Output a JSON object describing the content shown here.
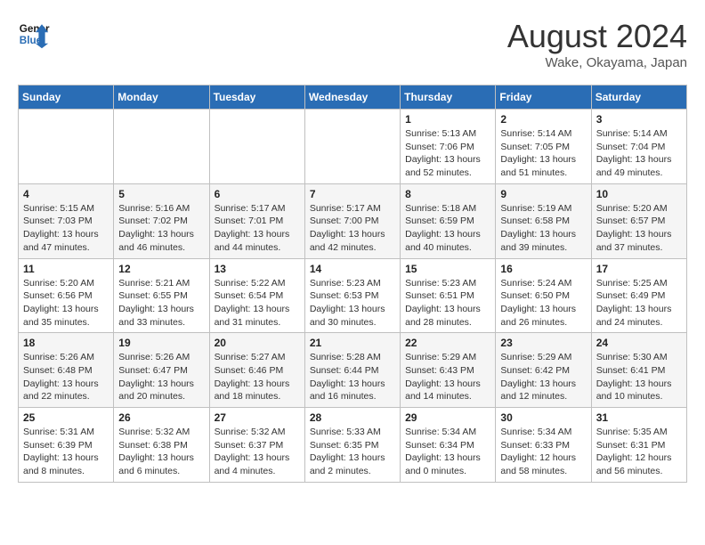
{
  "header": {
    "logo_line1": "General",
    "logo_line2": "Blue",
    "month_title": "August 2024",
    "location": "Wake, Okayama, Japan"
  },
  "weekdays": [
    "Sunday",
    "Monday",
    "Tuesday",
    "Wednesday",
    "Thursday",
    "Friday",
    "Saturday"
  ],
  "weeks": [
    [
      {
        "day": "",
        "info": ""
      },
      {
        "day": "",
        "info": ""
      },
      {
        "day": "",
        "info": ""
      },
      {
        "day": "",
        "info": ""
      },
      {
        "day": "1",
        "info": "Sunrise: 5:13 AM\nSunset: 7:06 PM\nDaylight: 13 hours\nand 52 minutes."
      },
      {
        "day": "2",
        "info": "Sunrise: 5:14 AM\nSunset: 7:05 PM\nDaylight: 13 hours\nand 51 minutes."
      },
      {
        "day": "3",
        "info": "Sunrise: 5:14 AM\nSunset: 7:04 PM\nDaylight: 13 hours\nand 49 minutes."
      }
    ],
    [
      {
        "day": "4",
        "info": "Sunrise: 5:15 AM\nSunset: 7:03 PM\nDaylight: 13 hours\nand 47 minutes."
      },
      {
        "day": "5",
        "info": "Sunrise: 5:16 AM\nSunset: 7:02 PM\nDaylight: 13 hours\nand 46 minutes."
      },
      {
        "day": "6",
        "info": "Sunrise: 5:17 AM\nSunset: 7:01 PM\nDaylight: 13 hours\nand 44 minutes."
      },
      {
        "day": "7",
        "info": "Sunrise: 5:17 AM\nSunset: 7:00 PM\nDaylight: 13 hours\nand 42 minutes."
      },
      {
        "day": "8",
        "info": "Sunrise: 5:18 AM\nSunset: 6:59 PM\nDaylight: 13 hours\nand 40 minutes."
      },
      {
        "day": "9",
        "info": "Sunrise: 5:19 AM\nSunset: 6:58 PM\nDaylight: 13 hours\nand 39 minutes."
      },
      {
        "day": "10",
        "info": "Sunrise: 5:20 AM\nSunset: 6:57 PM\nDaylight: 13 hours\nand 37 minutes."
      }
    ],
    [
      {
        "day": "11",
        "info": "Sunrise: 5:20 AM\nSunset: 6:56 PM\nDaylight: 13 hours\nand 35 minutes."
      },
      {
        "day": "12",
        "info": "Sunrise: 5:21 AM\nSunset: 6:55 PM\nDaylight: 13 hours\nand 33 minutes."
      },
      {
        "day": "13",
        "info": "Sunrise: 5:22 AM\nSunset: 6:54 PM\nDaylight: 13 hours\nand 31 minutes."
      },
      {
        "day": "14",
        "info": "Sunrise: 5:23 AM\nSunset: 6:53 PM\nDaylight: 13 hours\nand 30 minutes."
      },
      {
        "day": "15",
        "info": "Sunrise: 5:23 AM\nSunset: 6:51 PM\nDaylight: 13 hours\nand 28 minutes."
      },
      {
        "day": "16",
        "info": "Sunrise: 5:24 AM\nSunset: 6:50 PM\nDaylight: 13 hours\nand 26 minutes."
      },
      {
        "day": "17",
        "info": "Sunrise: 5:25 AM\nSunset: 6:49 PM\nDaylight: 13 hours\nand 24 minutes."
      }
    ],
    [
      {
        "day": "18",
        "info": "Sunrise: 5:26 AM\nSunset: 6:48 PM\nDaylight: 13 hours\nand 22 minutes."
      },
      {
        "day": "19",
        "info": "Sunrise: 5:26 AM\nSunset: 6:47 PM\nDaylight: 13 hours\nand 20 minutes."
      },
      {
        "day": "20",
        "info": "Sunrise: 5:27 AM\nSunset: 6:46 PM\nDaylight: 13 hours\nand 18 minutes."
      },
      {
        "day": "21",
        "info": "Sunrise: 5:28 AM\nSunset: 6:44 PM\nDaylight: 13 hours\nand 16 minutes."
      },
      {
        "day": "22",
        "info": "Sunrise: 5:29 AM\nSunset: 6:43 PM\nDaylight: 13 hours\nand 14 minutes."
      },
      {
        "day": "23",
        "info": "Sunrise: 5:29 AM\nSunset: 6:42 PM\nDaylight: 13 hours\nand 12 minutes."
      },
      {
        "day": "24",
        "info": "Sunrise: 5:30 AM\nSunset: 6:41 PM\nDaylight: 13 hours\nand 10 minutes."
      }
    ],
    [
      {
        "day": "25",
        "info": "Sunrise: 5:31 AM\nSunset: 6:39 PM\nDaylight: 13 hours\nand 8 minutes."
      },
      {
        "day": "26",
        "info": "Sunrise: 5:32 AM\nSunset: 6:38 PM\nDaylight: 13 hours\nand 6 minutes."
      },
      {
        "day": "27",
        "info": "Sunrise: 5:32 AM\nSunset: 6:37 PM\nDaylight: 13 hours\nand 4 minutes."
      },
      {
        "day": "28",
        "info": "Sunrise: 5:33 AM\nSunset: 6:35 PM\nDaylight: 13 hours\nand 2 minutes."
      },
      {
        "day": "29",
        "info": "Sunrise: 5:34 AM\nSunset: 6:34 PM\nDaylight: 13 hours\nand 0 minutes."
      },
      {
        "day": "30",
        "info": "Sunrise: 5:34 AM\nSunset: 6:33 PM\nDaylight: 12 hours\nand 58 minutes."
      },
      {
        "day": "31",
        "info": "Sunrise: 5:35 AM\nSunset: 6:31 PM\nDaylight: 12 hours\nand 56 minutes."
      }
    ]
  ]
}
